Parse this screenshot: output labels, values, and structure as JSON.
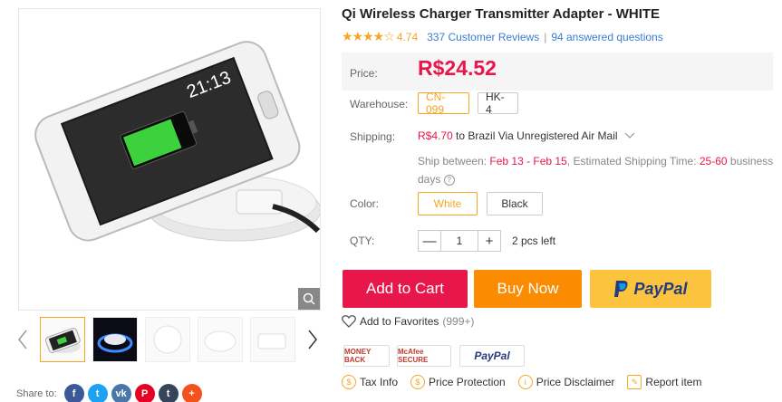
{
  "product": {
    "title": "Qi Wireless Charger Transmitter Adapter - WHITE",
    "stars": "★★★★☆",
    "rating": "4.74",
    "reviews_label": "337 Customer Reviews",
    "separator": "|",
    "questions_label": "94 answered questions"
  },
  "price": {
    "label": "Price:",
    "value": "R$24.52"
  },
  "warehouse": {
    "label": "Warehouse:",
    "options": [
      "CN-099",
      "HK-4"
    ],
    "selected": "CN-099"
  },
  "shipping": {
    "label": "Shipping:",
    "cost": "R$4.70",
    "method": " to Brazil Via Unregistered Air Mail",
    "between_label": "Ship between: ",
    "between_dates": "Feb 13 - Feb 15",
    "time_label": ", Estimated Shipping Time: ",
    "time_value": "25-60",
    "time_unit": " business days"
  },
  "color": {
    "label": "Color:",
    "options": [
      "White",
      "Black"
    ],
    "selected": "White"
  },
  "qty": {
    "label": "QTY:",
    "minus": "—",
    "value": "1",
    "plus": "+",
    "stock": "2 pcs left"
  },
  "actions": {
    "add_to_cart": "Add to Cart",
    "buy_now": "Buy Now",
    "paypal": "PayPal"
  },
  "favorites": {
    "label": "Add to Favorites",
    "count": "(999+)"
  },
  "badges": {
    "money_back": "MONEY BACK",
    "mcafee": "McAfee SECURE",
    "paypal": "PayPal"
  },
  "links": {
    "tax": "Tax Info",
    "protection": "Price Protection",
    "disclaimer": "Price Disclaimer",
    "report": "Report item"
  },
  "share": {
    "label": "Share to:",
    "networks": [
      "facebook-icon",
      "twitter-icon",
      "vk-icon",
      "pinterest-icon",
      "tumblr-icon",
      "google-plus-icon"
    ]
  },
  "gallery": {
    "screen_time": "21:13"
  },
  "colors": {
    "accent_red": "#e8174b",
    "accent_orange": "#f6a623",
    "buy_orange": "#fb8b00",
    "paypal_yellow": "#fbc33e",
    "link_blue": "#3a7bd5"
  }
}
